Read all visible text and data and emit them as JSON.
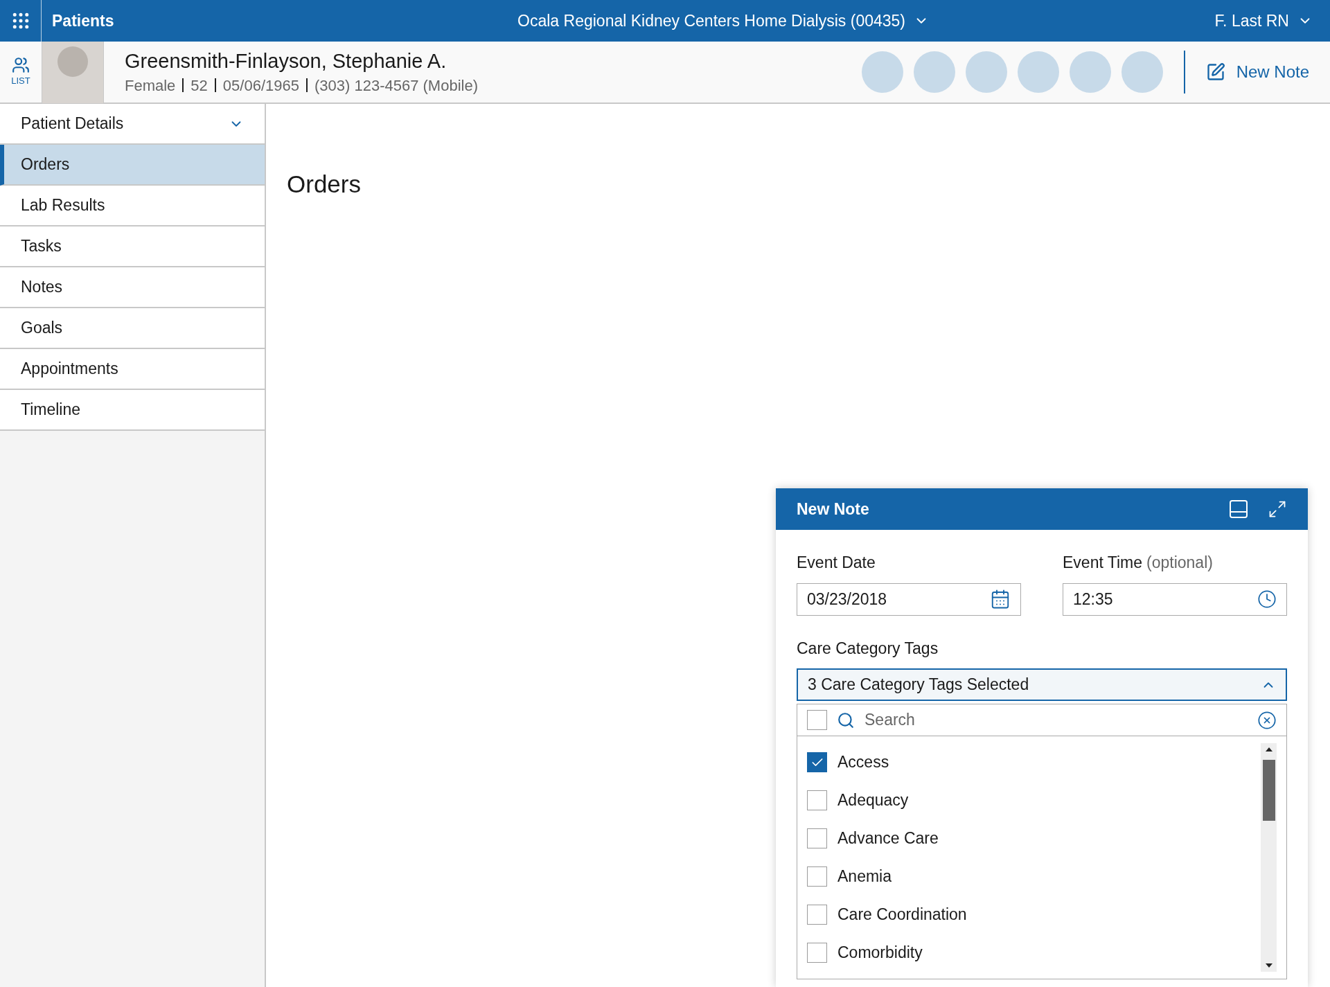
{
  "top_bar": {
    "app_label": "Patients",
    "organization": "Ocala Regional Kidney Centers Home Dialysis (00435)",
    "user": "F. Last RN"
  },
  "patient_header": {
    "list_label": "LIST",
    "name": "Greensmith-Finlayson, Stephanie A.",
    "details": [
      "Female",
      "52",
      "05/06/1965",
      "(303) 123-4567 (Mobile)"
    ],
    "new_note_label": "New Note"
  },
  "sidebar": {
    "section": {
      "label": "Patient Details",
      "expanded": true
    },
    "items": [
      {
        "label": "Orders",
        "selected": true
      },
      {
        "label": "Lab Results",
        "selected": false
      },
      {
        "label": "Tasks",
        "selected": false
      },
      {
        "label": "Notes",
        "selected": false
      },
      {
        "label": "Goals",
        "selected": false
      },
      {
        "label": "Appointments",
        "selected": false
      },
      {
        "label": "Timeline",
        "selected": false
      }
    ]
  },
  "main": {
    "title": "Orders"
  },
  "note_dialog": {
    "title": "New Note",
    "event_date": {
      "label": "Event Date",
      "value": "03/23/2018"
    },
    "event_time": {
      "label": "Event Time",
      "hint": "(optional)",
      "value": "12:35"
    },
    "tags": {
      "label": "Care Category Tags",
      "summary": "3 Care Category Tags Selected",
      "expanded": true,
      "select_all_checked": false,
      "search_placeholder": "Search",
      "options": [
        {
          "label": "Access",
          "checked": true
        },
        {
          "label": "Adequacy",
          "checked": false
        },
        {
          "label": "Advance Care",
          "checked": false
        },
        {
          "label": "Anemia",
          "checked": false
        },
        {
          "label": "Care Coordination",
          "checked": false
        },
        {
          "label": "Comorbidity",
          "checked": false
        }
      ]
    }
  }
}
